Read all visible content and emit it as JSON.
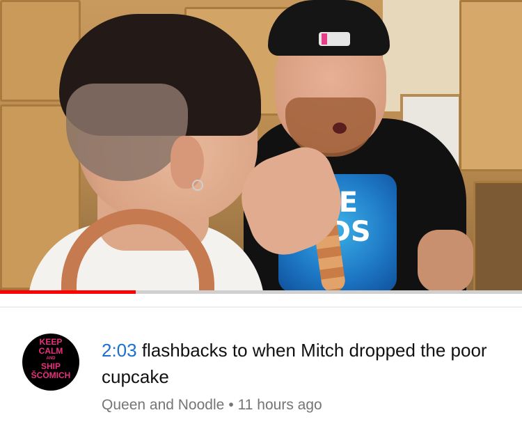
{
  "video": {
    "progress_fraction": 0.26,
    "shirt_text": "RE\nNDS"
  },
  "comment": {
    "avatar_text": [
      "KEEP",
      "CALM",
      "AND",
      "SHIP",
      "ŠCÖMICH"
    ],
    "timestamp": "2:03",
    "text": " flashbacks to when Mitch dropped the poor cupcake",
    "author": "Queen and Noodle",
    "separator": "•",
    "time_ago": "11 hours ago"
  },
  "colors": {
    "progress": "#ff0000",
    "timestamp_link": "#1a6fd1",
    "avatar_text": "#e8317c"
  }
}
